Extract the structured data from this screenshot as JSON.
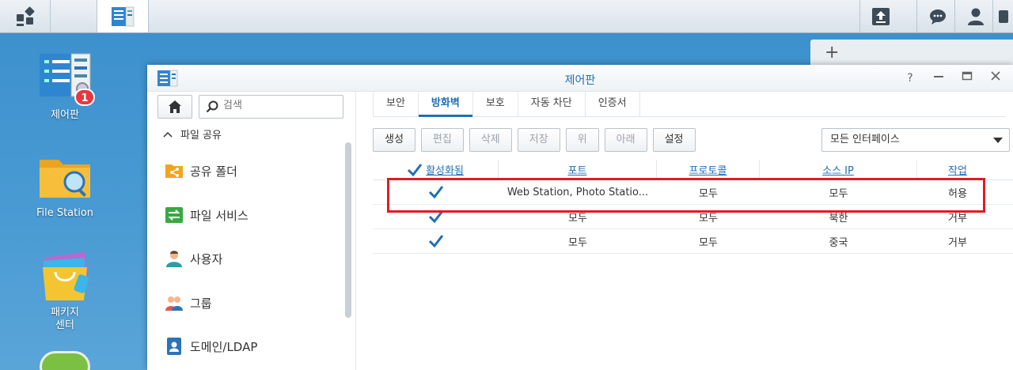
{
  "desktop": {
    "icons": [
      {
        "label": "제어판",
        "badge": "1"
      },
      {
        "label": "File Station"
      },
      {
        "label": "패키지\n센터"
      }
    ]
  },
  "window": {
    "title": "제어판"
  },
  "sidebar": {
    "search_placeholder": "검색",
    "section_label": "파일 공유",
    "items": [
      {
        "label": "공유 폴더"
      },
      {
        "label": "파일 서비스"
      },
      {
        "label": "사용자"
      },
      {
        "label": "그룹"
      },
      {
        "label": "도메인/LDAP"
      }
    ]
  },
  "tabs": [
    "보안",
    "방화벽",
    "보호",
    "자동 차단",
    "인증서"
  ],
  "toolbar": {
    "buttons": [
      "생성",
      "편집",
      "삭제",
      "저장",
      "위",
      "아래",
      "설정"
    ],
    "interface_select": "모든 인터페이스"
  },
  "table": {
    "headers": [
      "활성화됨",
      "포트",
      "프로토콜",
      "소스 IP",
      "작업"
    ],
    "rows": [
      {
        "port": "Web Station, Photo Statio...",
        "protocol": "모두",
        "source": "모두",
        "action": "허용"
      },
      {
        "port": "모두",
        "protocol": "모두",
        "source": "북한",
        "action": "거부"
      },
      {
        "port": "모두",
        "protocol": "모두",
        "source": "중국",
        "action": "거부"
      }
    ]
  },
  "colors": {
    "accent": "#1f6fb7",
    "highlight": "#e01b24",
    "desktop": "#3f93cd"
  }
}
